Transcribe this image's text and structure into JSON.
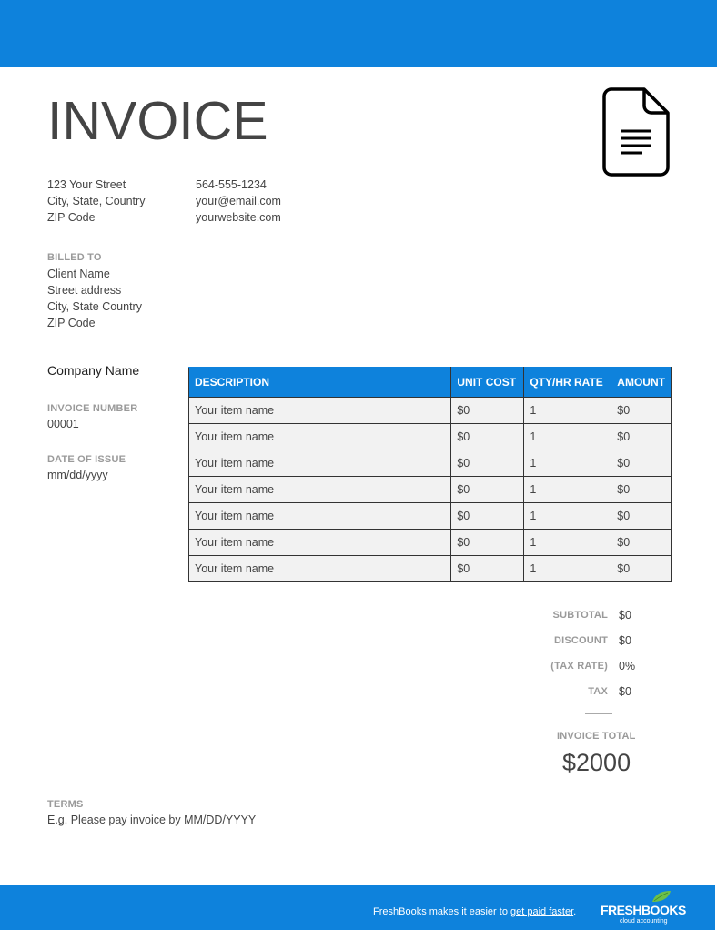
{
  "header": {
    "title": "INVOICE",
    "icon": "document-icon"
  },
  "sender": {
    "address": [
      "123 Your Street",
      "City, State, Country",
      "ZIP Code"
    ],
    "contact": [
      "564-555-1234",
      "your@email.com",
      "yourwebsite.com"
    ]
  },
  "billed_to": {
    "label": "BILLED TO",
    "lines": [
      "Client Name",
      "Street address",
      "City, State Country",
      "ZIP Code"
    ]
  },
  "company_name": "Company Name",
  "invoice_number": {
    "label": "INVOICE NUMBER",
    "value": "00001"
  },
  "date_of_issue": {
    "label": "DATE OF ISSUE",
    "value": "mm/dd/yyyy"
  },
  "table": {
    "headers": [
      "DESCRIPTION",
      "UNIT COST",
      "QTY/HR RATE",
      "AMOUNT"
    ],
    "rows": [
      [
        "Your item name",
        "$0",
        "1",
        "$0"
      ],
      [
        "Your item name",
        "$0",
        "1",
        "$0"
      ],
      [
        "Your item name",
        "$0",
        "1",
        "$0"
      ],
      [
        "Your item name",
        "$0",
        "1",
        "$0"
      ],
      [
        "Your item name",
        "$0",
        "1",
        "$0"
      ],
      [
        "Your item name",
        "$0",
        "1",
        "$0"
      ],
      [
        "Your item name",
        "$0",
        "1",
        "$0"
      ]
    ]
  },
  "totals": [
    {
      "label": "SUBTOTAL",
      "value": "$0"
    },
    {
      "label": "DISCOUNT",
      "value": "$0"
    },
    {
      "label": "(TAX RATE)",
      "value": "0%"
    },
    {
      "label": "TAX",
      "value": "$0"
    }
  ],
  "invoice_total": {
    "label": "INVOICE TOTAL",
    "value": "$2000"
  },
  "terms": {
    "label": "TERMS",
    "value": "E.g. Please pay invoice by MM/DD/YYYY"
  },
  "footer": {
    "text": "FreshBooks makes it easier to ",
    "link": "get paid faster",
    "suffix": ".",
    "brand": "FRESHBOOKS",
    "brand_sub": "cloud accounting"
  },
  "colors": {
    "accent": "#0e82dc",
    "label_gray": "#9a9a9a",
    "text": "#444444",
    "row_bg": "#f2f2f2",
    "leaf_green": "#6cc04a"
  }
}
